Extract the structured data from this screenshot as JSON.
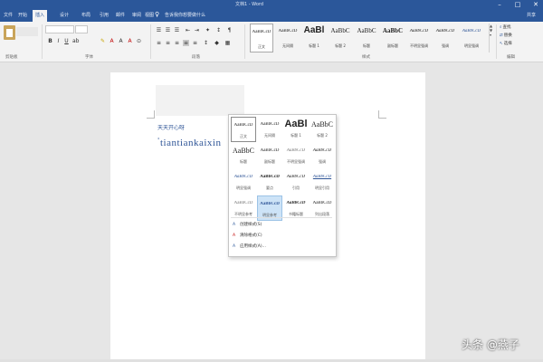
{
  "window": {
    "title": "文档1 - Word",
    "min_icon": "minimize-icon",
    "max_icon": "maximize-icon",
    "close_icon": "close-icon"
  },
  "tabs": [
    {
      "label": "文件",
      "active": false
    },
    {
      "label": "开始",
      "active": true
    },
    {
      "label": "插入",
      "active": false
    },
    {
      "label": "设计",
      "active": false
    },
    {
      "label": "布局",
      "active": false
    },
    {
      "label": "引用",
      "active": false
    },
    {
      "label": "邮件",
      "active": false
    },
    {
      "label": "审阅",
      "active": false
    },
    {
      "label": "视图",
      "active": false
    }
  ],
  "tell_me": "告诉我你想要做什么",
  "share": "共享",
  "ribbon": {
    "groups": [
      "剪贴板",
      "字体",
      "段落",
      "样式",
      "编辑"
    ],
    "editing": [
      "查找",
      "替换",
      "选择"
    ],
    "gallery": [
      {
        "sample": "AaBbCcD",
        "name": "正文",
        "size": 5
      },
      {
        "sample": "AaBbCcD",
        "name": "无间隔",
        "size": 5
      },
      {
        "sample": "AaBl",
        "name": "标题 1",
        "size": 10
      },
      {
        "sample": "AaBbC",
        "name": "标题 2",
        "size": 7
      },
      {
        "sample": "AaBbC",
        "name": "标题",
        "size": 7
      },
      {
        "sample": "AaBbC",
        "name": "副标题",
        "size": 7
      },
      {
        "sample": "AaBbCcD",
        "name": "不明显强调",
        "size": 5
      },
      {
        "sample": "AaBbCcD",
        "name": "强调",
        "size": 5
      },
      {
        "sample": "AaBbCcD",
        "name": "明显强调",
        "size": 5
      }
    ]
  },
  "document": {
    "heading": "天天开心呀",
    "text": "tiantiankaixin"
  },
  "styles_dropdown": {
    "tiles": [
      {
        "sample": "AaBbCcD",
        "name": "正文"
      },
      {
        "sample": "AaBbCcD",
        "name": "无间隔"
      },
      {
        "sample": "AaBl",
        "name": "标题 1"
      },
      {
        "sample": "AaBbC",
        "name": "标题 2"
      },
      {
        "sample": "AaBbC",
        "name": "标题"
      },
      {
        "sample": "AaBbCcD",
        "name": "副标题"
      },
      {
        "sample": "AaBbCcD",
        "name": "不明显强调"
      },
      {
        "sample": "AaBbCcD",
        "name": "强调"
      },
      {
        "sample": "AaBbCcD",
        "name": "明显强调"
      },
      {
        "sample": "AaBbCcD",
        "name": "要点"
      },
      {
        "sample": "AaBbCcD",
        "name": "引用"
      },
      {
        "sample": "AaBbCcD",
        "name": "明显引用"
      },
      {
        "sample": "AaBbCcD",
        "name": "不明显参考"
      },
      {
        "sample": "AaBbCcD",
        "name": "明显参考"
      },
      {
        "sample": "AaBbCcD",
        "name": "书籍标题"
      },
      {
        "sample": "AaBbCcD",
        "name": "列出段落"
      }
    ],
    "actions": [
      "创建样式(S)",
      "清除格式(C)",
      "应用样式(A)..."
    ]
  },
  "watermark": "头条 @燕子",
  "colors": {
    "brand": "#2b579a",
    "doc_text": "#2f5597",
    "highlight": "#cde3f7"
  }
}
